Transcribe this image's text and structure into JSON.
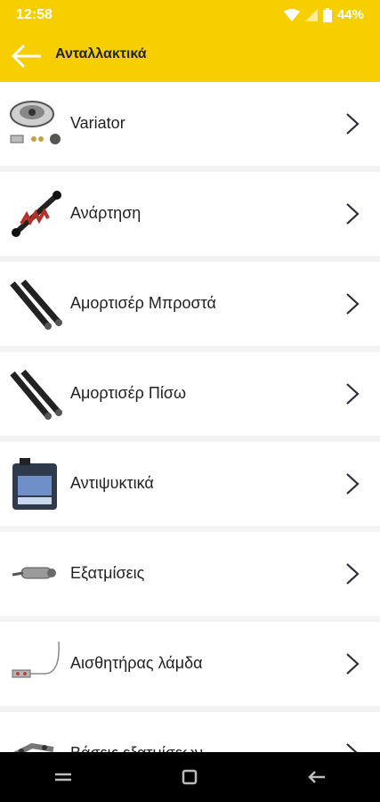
{
  "status": {
    "time": "12:58",
    "battery": "44%"
  },
  "appbar": {
    "title": "Ανταλλακτικά"
  },
  "items": [
    {
      "label": "Variator",
      "icon": "variator-icon"
    },
    {
      "label": "Ανάρτηση",
      "icon": "suspension-spring-icon"
    },
    {
      "label": "Αμορτισέρ Μπροστά",
      "icon": "front-shock-absorber-icon"
    },
    {
      "label": "Αμορτισέρ Πίσω",
      "icon": "rear-shock-absorber-icon"
    },
    {
      "label": "Αντιψυκτικά",
      "icon": "antifreeze-can-icon"
    },
    {
      "label": "Εξατμίσεις",
      "icon": "exhaust-icon"
    },
    {
      "label": "Αισθητήρας λάμδα",
      "icon": "lambda-sensor-icon"
    },
    {
      "label": "Βάσεις εξατμίσεων",
      "icon": "exhaust-bracket-icon"
    }
  ],
  "colors": {
    "accent": "#f7ce00",
    "navbar": "#000000",
    "chevron": "#2b2b3a"
  }
}
